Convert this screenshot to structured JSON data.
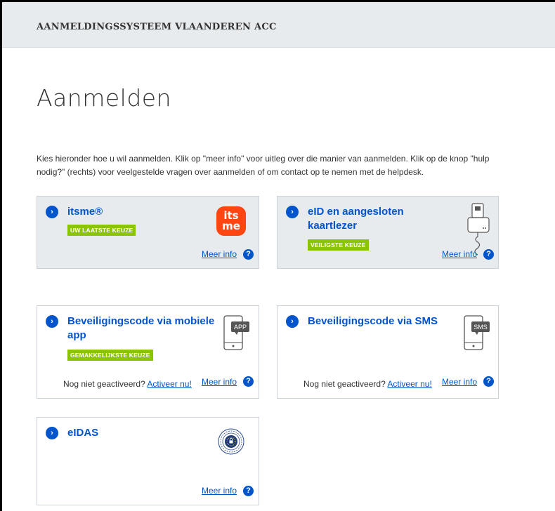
{
  "header": {
    "title": "AANMELDINGSSYSTEEM VLAANDEREN ACC"
  },
  "page": {
    "title": "Aanmelden",
    "intro": "Kies hieronder hoe u wil aanmelden. Klik op \"meer info\" voor uitleg over die manier van aanmelden. Klik op de knop \"hulp nodig?\" (rechts) voor veelgestelde vragen over aanmelden of om contact op te nemen met de helpdesk."
  },
  "common": {
    "meer_info": "Meer info",
    "help_glyph": "?",
    "chevron_glyph": "›",
    "nog_niet": "Nog niet geactiveerd?",
    "activeer": "Activeer nu!"
  },
  "cards": {
    "itsme": {
      "title": "itsme®",
      "badge": "UW LAATSTE KEUZE",
      "logo_top": "its",
      "logo_bottom": "me",
      "icon": "itsme-logo"
    },
    "eid": {
      "title_line1": "eID en aangesloten",
      "title_line2": "kaartlezer",
      "badge": "VEILIGSTE KEUZE",
      "icon": "card-reader-icon"
    },
    "app": {
      "title_line1": "Beveiligingscode via mobiele",
      "title_line2": "app",
      "badge": "GEMAKKELIJKSTE KEUZE",
      "icon_label": "APP",
      "icon": "phone-app-icon"
    },
    "sms": {
      "title": "Beveiligingscode via SMS",
      "icon_label": "SMS",
      "icon": "phone-sms-icon"
    },
    "eidas": {
      "title": "eIDAS",
      "icon": "eidas-seal-icon"
    }
  },
  "colors": {
    "link": "#0055cc",
    "badge": "#8bc400",
    "header_bg": "#e8ebee",
    "itsme": "#ff4612"
  }
}
